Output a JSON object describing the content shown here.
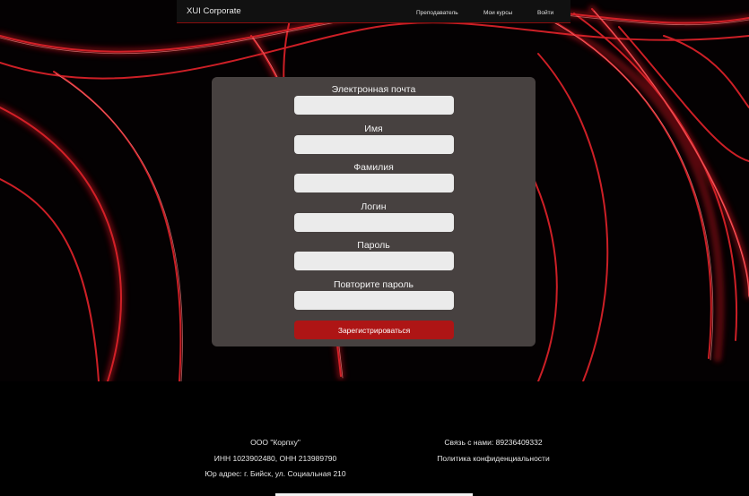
{
  "header": {
    "brand": "XUI Corporate",
    "nav": [
      "Преподаватель",
      "Мои курсы",
      "Войти"
    ]
  },
  "form": {
    "fields": [
      {
        "label": "Электронная почта",
        "value": ""
      },
      {
        "label": "Имя",
        "value": ""
      },
      {
        "label": "Фамилия",
        "value": ""
      },
      {
        "label": "Логин",
        "value": ""
      },
      {
        "label": "Пароль",
        "value": ""
      },
      {
        "label": "Повторите пароль",
        "value": ""
      }
    ],
    "submit_label": "Зарегистрироваться"
  },
  "footer": {
    "company": "ООО \"Корпху\"",
    "ids": "ИНН 1023902480, ОНН 213989790",
    "address": "Юр адрес: г. Бийск, ул. Социальная 210",
    "contact": "Связь с нами: 89236409332",
    "privacy": "Политика конфиденциальности"
  },
  "colors": {
    "accent": "#ae1515",
    "card": "#474140",
    "page": "#000000"
  }
}
